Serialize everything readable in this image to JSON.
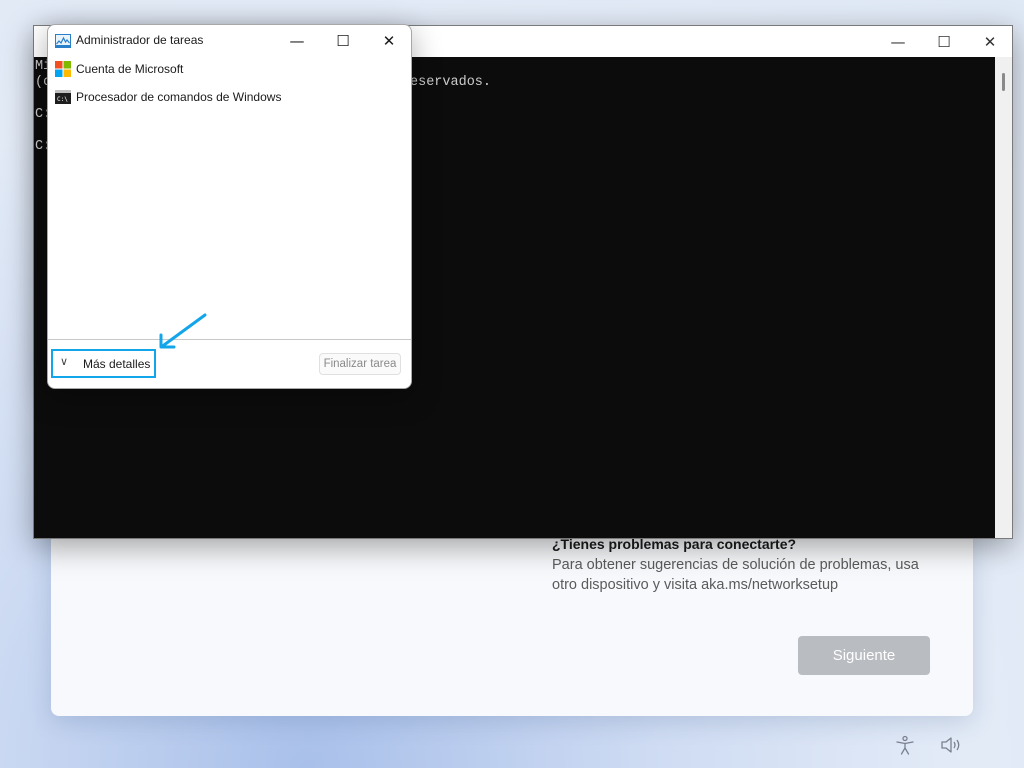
{
  "oobe": {
    "help_title": "¿Tienes problemas para conectarte?",
    "help_body": "Para obtener sugerencias de solución de problemas, usa otro dispositivo y visita aka.ms/networksetup",
    "next_button": "Siguiente"
  },
  "cmd": {
    "lines": [
      "Mi",
      "(c",
      "eservados.",
      "C:",
      "C:"
    ],
    "controls": {
      "minimize": "—",
      "maximize": "☐",
      "close": "✕"
    }
  },
  "task_manager": {
    "title": "Administrador de tareas",
    "apps": [
      {
        "name": "Cuenta de Microsoft",
        "icon": "microsoft-logo-icon"
      },
      {
        "name": "Procesador de comandos de Windows",
        "icon": "cmd-icon"
      }
    ],
    "more_details": "Más detalles",
    "end_task": "Finalizar tarea",
    "controls": {
      "minimize": "—",
      "maximize": "☐",
      "close": "✕"
    }
  },
  "colors": {
    "highlight": "#12a5ea",
    "console_bg": "#0c0c0c",
    "next_button": "#b9bcc1"
  },
  "tray": {
    "icons": [
      "accessibility-icon",
      "speaker-icon"
    ]
  }
}
